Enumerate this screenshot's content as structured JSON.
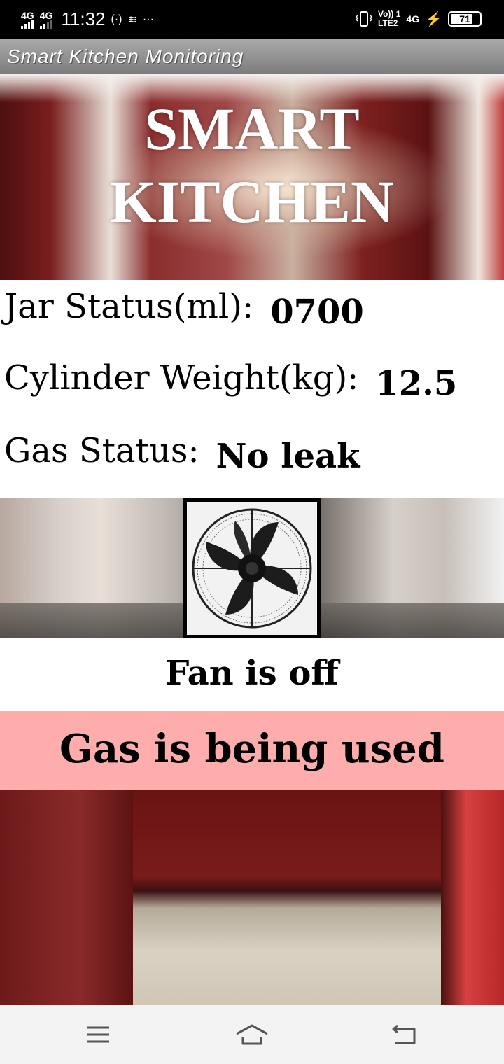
{
  "status_bar": {
    "sim1": "4G",
    "sim2": "4G",
    "time": "11:32",
    "more": "···",
    "volte_top": "Vo)) 1",
    "volte_bottom": "LTE2",
    "net": "4G",
    "battery": "71"
  },
  "app_bar": {
    "title": "Smart Kitchen Monitoring"
  },
  "hero": {
    "title_line1": "SMART",
    "title_line2": "KITCHEN"
  },
  "status": {
    "jar_label": "Jar Status(ml):",
    "jar_value": "0700",
    "cylinder_label": "Cylinder Weight(kg):",
    "cylinder_value": "12.5",
    "gas_label": "Gas Status:",
    "gas_value": "No leak"
  },
  "fan": {
    "icon": "fan-icon",
    "state": "Fan is off"
  },
  "banner": {
    "text": "Gas is being used",
    "color": "#feadad"
  },
  "nav_bar": {
    "icons": [
      "menu-icon",
      "home-icon",
      "back-icon"
    ]
  }
}
